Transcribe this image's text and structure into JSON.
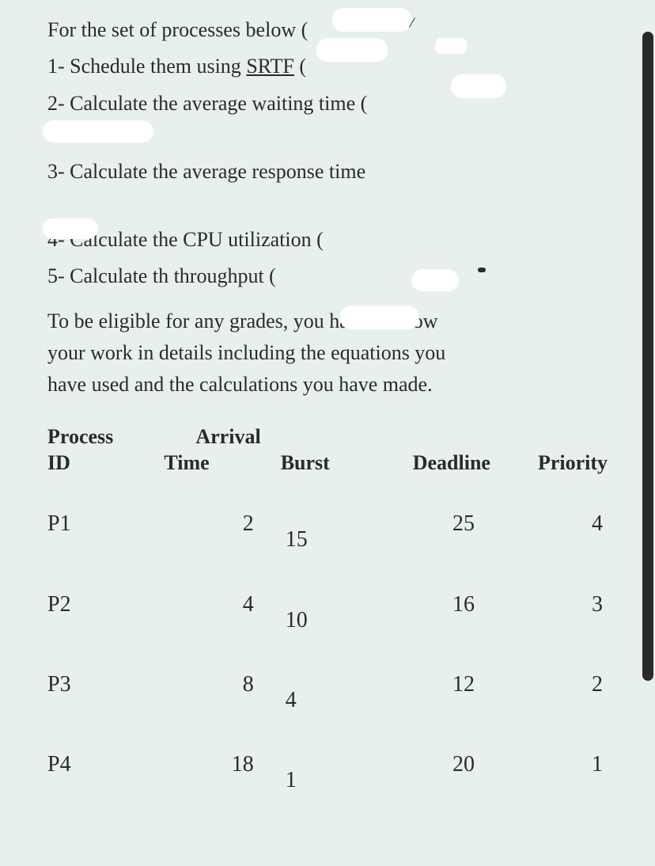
{
  "question": {
    "intro": "For the set of processes below (",
    "items": [
      {
        "prefix": "1- ",
        "text_pre": "Schedule them using ",
        "srtf": "SRTF",
        "text_post": " ("
      },
      {
        "prefix": "2-  ",
        "text": "Calculate the average waiting time  ("
      },
      {
        "prefix": "3-  ",
        "text": "Calculate the average response time"
      },
      {
        "prefix": "4-  ",
        "text": "Calculate the CPU utilization  ("
      },
      {
        "prefix": "5-  ",
        "text": "Calculate th throughput  ("
      }
    ],
    "note_l1": "To be eligible for any grades, you have to show",
    "note_l2": "your work in details including the equations you",
    "note_l3": "have used and the calculations you have made."
  },
  "table": {
    "headers": {
      "process_id_l1": "Process",
      "process_id_l2": "ID",
      "arrival_l1": "Arrival",
      "arrival_l2": "Time",
      "burst": "Burst",
      "deadline": "Deadline",
      "priority": "Priority"
    },
    "rows": [
      {
        "id": "P1",
        "arrival": "2",
        "burst": "15",
        "deadline": "25",
        "priority": "4"
      },
      {
        "id": "P2",
        "arrival": "4",
        "burst": "10",
        "deadline": "16",
        "priority": "3"
      },
      {
        "id": "P3",
        "arrival": "8",
        "burst": "4",
        "deadline": "12",
        "priority": "2"
      },
      {
        "id": "P4",
        "arrival": "18",
        "burst": "1",
        "deadline": "20",
        "priority": "1"
      }
    ]
  }
}
